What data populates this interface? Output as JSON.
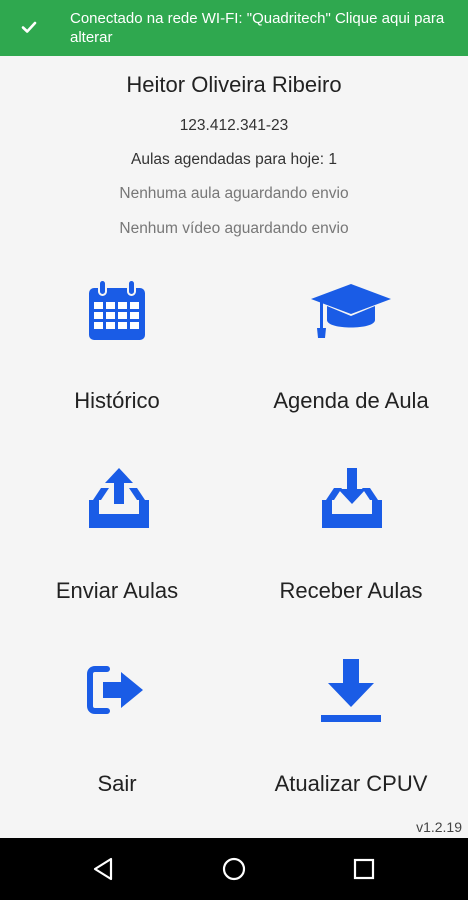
{
  "banner": {
    "text": "Conectado na rede WI-FI: \"Quadritech\" Clique aqui para alterar"
  },
  "user": {
    "name": "Heitor Oliveira Ribeiro",
    "cpf": "123.412.341-23",
    "scheduled": "Aulas agendadas para hoje: 1",
    "pending_classes": "Nenhuma aula aguardando envio",
    "pending_videos": "Nenhum vídeo aguardando envio"
  },
  "menu": {
    "historico": "Histórico",
    "agenda": "Agenda de Aula",
    "enviar": "Enviar Aulas",
    "receber": "Receber Aulas",
    "sair": "Sair",
    "atualizar": "Atualizar CPUV"
  },
  "version": "v1.2.19",
  "colors": {
    "accent": "#1a5ce6",
    "banner": "#2fa84f"
  },
  "icons": {
    "banner": "check-icon",
    "historico": "calendar-icon",
    "agenda": "graduation-cap-icon",
    "enviar": "upload-tray-icon",
    "receber": "download-tray-icon",
    "sair": "exit-icon",
    "atualizar": "download-icon",
    "nav": [
      "back-icon",
      "home-icon",
      "recents-icon"
    ]
  }
}
